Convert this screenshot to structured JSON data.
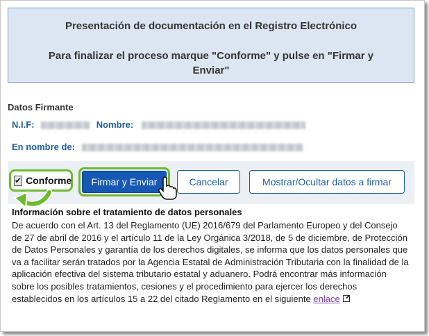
{
  "header": {
    "title": "Presentación de documentación en el Registro Electrónico",
    "instruction": "Para finalizar el proceso marque \"Conforme\" y pulse en \"Firmar y Enviar\""
  },
  "signer": {
    "section_title": "Datos Firmante",
    "nif_label": "N.I.F:",
    "nombre_label": "Nombre:",
    "on_behalf_label": "En nombre de:"
  },
  "actions": {
    "conforme_label": "Conforme",
    "conforme_checked": true,
    "sign_button": "Firmar y Enviar",
    "cancel_button": "Cancelar",
    "toggle_data_button": "Mostrar/Ocultar datos a firmar"
  },
  "privacy": {
    "title": "Información sobre el tratamiento de datos personales",
    "body": "De acuerdo con el Art. 13 del Reglamento (UE) 2016/679 del Parlamento Europeo y del Consejo de 27 de abril de 2016 y el artículo 11 de la Ley Orgánica 3/2018, de 5 de diciembre, de Protección de Datos Personales y garantía de los derechos digitales, se informa que los datos personales que va a facilitar serán tratados por la Agencia Estatal de Administración Tributaria con la finalidad de la aplicación efectiva del sistema tributario estatal y aduanero. Podrá encontrar más información sobre los posibles tratamientos, cesiones y el procedimiento para ejercer los derechos establecidos en los artículos 15 a 22 del citado Reglamento en el siguiente",
    "link_text": "enlace"
  },
  "icons": {
    "arrow": "green-arrow-icon",
    "cursor": "hand-pointer-icon",
    "external": "external-link-icon"
  },
  "colors": {
    "accent_green": "#6dbb2d",
    "primary_blue": "#1658b4",
    "label_blue": "#1c5ea3",
    "header_bg": "#dbe6f2"
  }
}
